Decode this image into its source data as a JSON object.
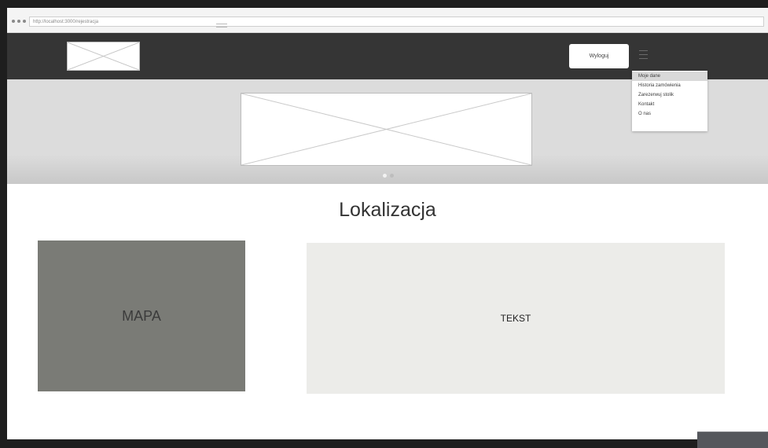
{
  "browser": {
    "url": "http://localhost:3000/rejestracja"
  },
  "header": {
    "logout_label": "Wyloguj"
  },
  "menu": {
    "items": [
      {
        "label": "Moje dane"
      },
      {
        "label": "Historia zamówienia"
      },
      {
        "label": "Zarezerwuj stolik"
      },
      {
        "label": "Kontakt"
      },
      {
        "label": "O nas"
      }
    ]
  },
  "main": {
    "title": "Lokalizacja",
    "map_label": "MAPA",
    "text_label": "TEKST"
  },
  "colors": {
    "header_bg": "#353535",
    "banner_bg": "#dcdcdc",
    "map_bg": "#7a7b76",
    "text_bg": "#ecece9"
  },
  "icons": {
    "menu": "hamburger-icon",
    "placeholder": "image-placeholder-icon"
  }
}
